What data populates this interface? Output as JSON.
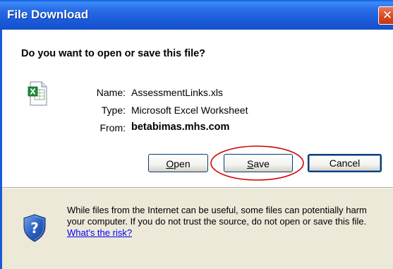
{
  "window": {
    "title": "File Download",
    "close_glyph": "✕"
  },
  "dialog": {
    "question": "Do you want to open or save this file?",
    "file_icon": "excel-file-icon",
    "name_label": "Name:",
    "name_value": "AssessmentLinks.xls",
    "type_label": "Type:",
    "type_value": "Microsoft Excel Worksheet",
    "from_label": "From:",
    "from_value": "betabimas.mhs.com"
  },
  "buttons": {
    "open_label": "Open",
    "open_mnemonic": "O",
    "open_rest": "pen",
    "save_label": "Save",
    "save_mnemonic": "S",
    "save_rest": "ave",
    "cancel_label": "Cancel"
  },
  "warning": {
    "icon": "security-shield-icon",
    "text": "While files from the Internet can be useful, some files can potentially harm your computer. If you do not trust the source, do not open or save this file.",
    "link_text": "What's the risk?"
  },
  "colors": {
    "titlebar": "#1a5ad8",
    "dialog_bg": "#ece9d8",
    "highlight_ellipse": "#d40000",
    "link": "#0000ff"
  }
}
